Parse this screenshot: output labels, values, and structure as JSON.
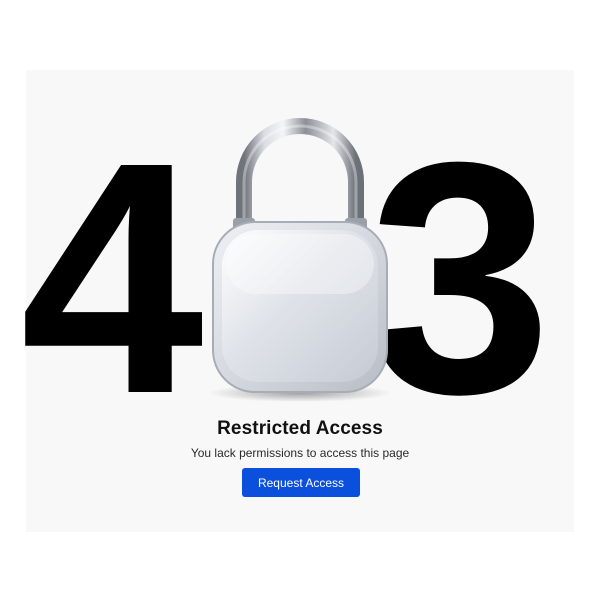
{
  "error": {
    "digit_left": "4",
    "digit_right": "3"
  },
  "message": {
    "title": "Restricted Access",
    "subtitle": "You lack permissions to access this page"
  },
  "actions": {
    "request_label": "Request Access"
  },
  "icons": {
    "padlock": "padlock-icon"
  },
  "colors": {
    "background": "#f8f8f8",
    "digits": "#000000",
    "button": "#0b4fdd",
    "button_text": "#ffffff"
  }
}
